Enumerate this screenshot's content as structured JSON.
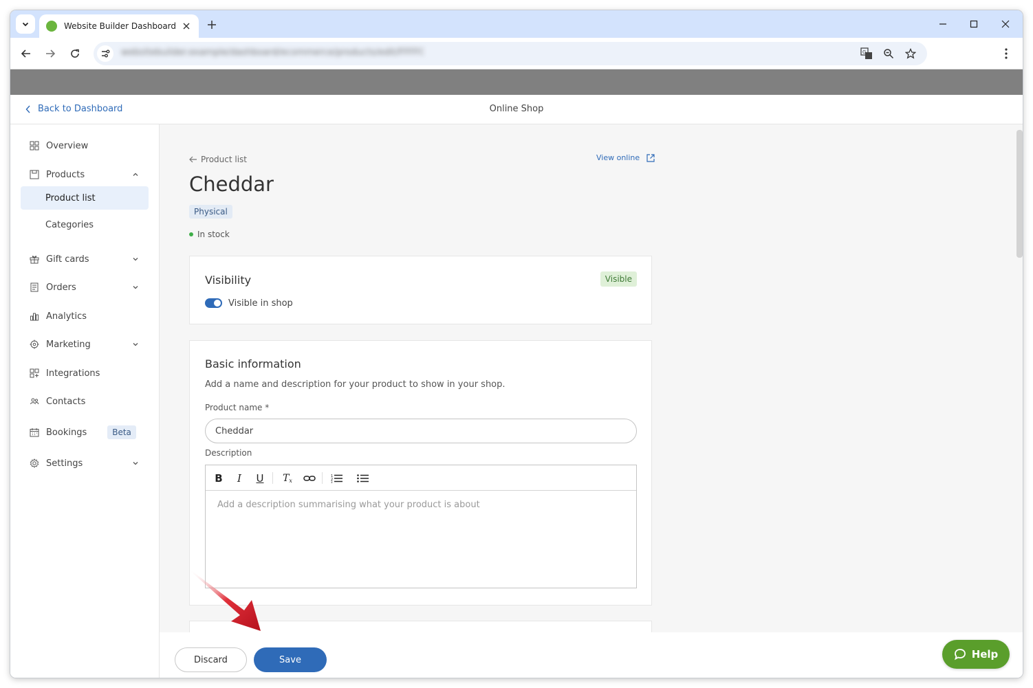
{
  "browser": {
    "tab_title": "Website Builder Dashboard",
    "url": "websitebuilder.example/dashboard/ecommerce/products/edit/FFFFCCD",
    "favicon_color": "#6bb53e"
  },
  "header": {
    "back_label": "Back to Dashboard",
    "title": "Online Shop"
  },
  "sidebar": {
    "items": [
      {
        "label": "Overview",
        "icon": "grid-icon"
      },
      {
        "label": "Products",
        "icon": "products-icon"
      },
      {
        "label": "Product list"
      },
      {
        "label": "Categories"
      },
      {
        "label": "Gift cards",
        "icon": "gift-icon"
      },
      {
        "label": "Orders",
        "icon": "orders-icon"
      },
      {
        "label": "Analytics",
        "icon": "analytics-icon"
      },
      {
        "label": "Marketing",
        "icon": "marketing-icon"
      },
      {
        "label": "Integrations",
        "icon": "integrations-icon"
      },
      {
        "label": "Contacts",
        "icon": "contacts-icon"
      },
      {
        "label": "Bookings",
        "icon": "calendar-icon",
        "badge": "Beta"
      },
      {
        "label": "Settings",
        "icon": "gear-icon"
      }
    ]
  },
  "product": {
    "breadcrumb": "Product list",
    "view_online": "View online",
    "name": "Cheddar",
    "type": "Physical",
    "stock": "In stock"
  },
  "visibility": {
    "title": "Visibility",
    "badge": "Visible",
    "toggle_label": "Visible in shop",
    "enabled": true
  },
  "basic_info": {
    "title": "Basic information",
    "description": "Add a name and description for your product to show in your shop.",
    "name_label": "Product name *",
    "name_value": "Cheddar",
    "description_label": "Description",
    "description_placeholder": "Add a description summarising what your product is about"
  },
  "actions": {
    "discard": "Discard",
    "save": "Save",
    "help": "Help"
  },
  "colors": {
    "accent": "#2f6bb8",
    "help": "#5a9e2b",
    "annotation": "#d0202a"
  }
}
